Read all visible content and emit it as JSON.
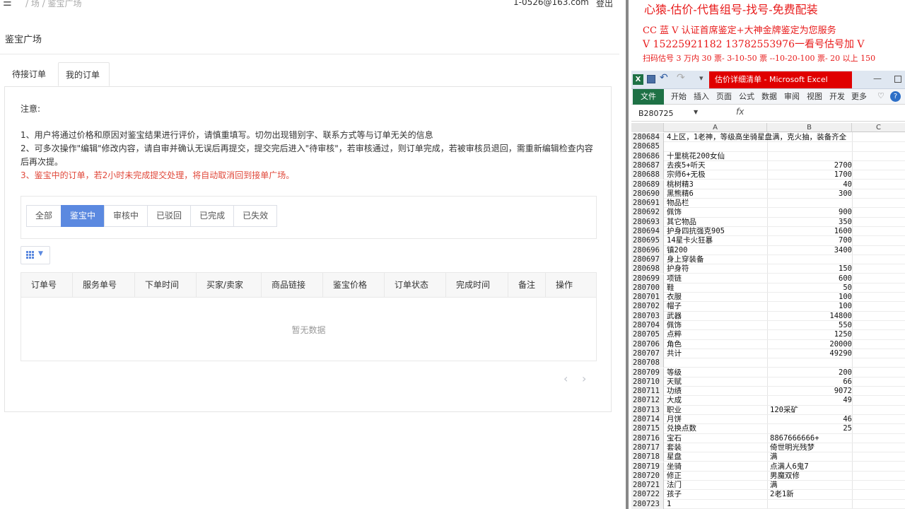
{
  "app": {
    "breadcrumb": "/ 场 / 鉴宝广场",
    "user_email": "1-0526@163.com",
    "logout": "登出",
    "page_title": "鉴宝广场",
    "tabs": [
      "待接订单",
      "我的订单"
    ],
    "notice": {
      "heading": "注意:",
      "line1": "1、用户将通过价格和原因对鉴宝结果进行评价，请慎重填写。切勿出现错别字、联系方式等与订单无关的信息",
      "line2": "2、可多次操作\"编辑\"修改内容，请自审并确认无误后再提交，提交完后进入\"待审核\"，若审核通过，则订单完成，若被审核员退回，需重新编辑检查内容后再次提。",
      "line3": "3、鉴宝中的订单，若2小时未完成提交处理，将自动取消回到接单广场。"
    },
    "filters": [
      "全部",
      "鉴宝中",
      "审核中",
      "已驳回",
      "已完成",
      "已失效"
    ],
    "active_filter": "鉴宝中",
    "columns": [
      "订单号",
      "服务单号",
      "下单时间",
      "买家/卖家",
      "商品链接",
      "鉴宝价格",
      "订单状态",
      "完成时间",
      "备注",
      "操作"
    ],
    "empty_text": "暂无数据",
    "accent_color": "#5b89e0"
  },
  "ad": {
    "line1": "心猿-估价-代售组号-找号-免费配装",
    "line2": "CC 蓝 V 认证首席鉴定+大神金牌鉴定为您服务",
    "line3": "V 15225921182    13782553976一看号估号加 V",
    "line4": "扫码估号 3 万内 30 票- 3-10-50 票 --10-20-100 票- 20 以上 150",
    "line5": "...",
    "color": "#e81b1b"
  },
  "excel": {
    "title": "估价详细清单 - Microsoft Excel",
    "file_tab": "文件",
    "ribbon_tabs": [
      "开始",
      "插入",
      "页面",
      "公式",
      "数据",
      "审阅",
      "视图",
      "开发",
      "更多"
    ],
    "name_box": "B280725",
    "fx": "fx",
    "col_headers": [
      "A",
      "B",
      "C"
    ],
    "rows": [
      {
        "n": "280684",
        "a": "4上区，1老神，等级高坐骑星盘满，克火抽，装备齐全",
        "b": "",
        "num": false
      },
      {
        "n": "280685",
        "a": "",
        "b": "",
        "num": false
      },
      {
        "n": "280686",
        "a": "十里桃花200女仙",
        "b": "",
        "num": false
      },
      {
        "n": "280687",
        "a": "去疾5+听天",
        "b": "2700",
        "num": true
      },
      {
        "n": "280688",
        "a": "宗师6+无极",
        "b": "1700",
        "num": true
      },
      {
        "n": "280689",
        "a": "桃树精3",
        "b": "40",
        "num": true
      },
      {
        "n": "280690",
        "a": "黑熊精6",
        "b": "300",
        "num": true
      },
      {
        "n": "280691",
        "a": "物品栏",
        "b": "",
        "num": false
      },
      {
        "n": "280692",
        "a": "佩饰",
        "b": "900",
        "num": true
      },
      {
        "n": "280693",
        "a": "其它物品",
        "b": "350",
        "num": true
      },
      {
        "n": "280694",
        "a": "护身四抗强克905",
        "b": "1600",
        "num": true
      },
      {
        "n": "280695",
        "a": "14星卡火狂暴",
        "b": "700",
        "num": true
      },
      {
        "n": "280696",
        "a": "镇200",
        "b": "3400",
        "num": true
      },
      {
        "n": "280697",
        "a": "身上穿装备",
        "b": "",
        "num": false
      },
      {
        "n": "280698",
        "a": "护身符",
        "b": "150",
        "num": true
      },
      {
        "n": "280699",
        "a": "项链",
        "b": "600",
        "num": true
      },
      {
        "n": "280700",
        "a": "鞋",
        "b": "50",
        "num": true
      },
      {
        "n": "280701",
        "a": "衣服",
        "b": "100",
        "num": true
      },
      {
        "n": "280702",
        "a": "帽子",
        "b": "100",
        "num": true
      },
      {
        "n": "280703",
        "a": "武器",
        "b": "14800",
        "num": true
      },
      {
        "n": "280704",
        "a": "佩饰",
        "b": "550",
        "num": true
      },
      {
        "n": "280705",
        "a": "点粹",
        "b": "1250",
        "num": true
      },
      {
        "n": "280706",
        "a": "角色",
        "b": "20000",
        "num": true
      },
      {
        "n": "280707",
        "a": "共计",
        "b": "49290",
        "num": true
      },
      {
        "n": "280708",
        "a": "",
        "b": "",
        "num": false
      },
      {
        "n": "280709",
        "a": "等级",
        "b": "200",
        "num": true
      },
      {
        "n": "280710",
        "a": "天赋",
        "b": "66",
        "num": true
      },
      {
        "n": "280711",
        "a": "功绩",
        "b": "9072",
        "num": true
      },
      {
        "n": "280712",
        "a": "大成",
        "b": "49",
        "num": true
      },
      {
        "n": "280713",
        "a": "职业",
        "b": "120采矿",
        "num": false
      },
      {
        "n": "280714",
        "a": "月饼",
        "b": "46",
        "num": true
      },
      {
        "n": "280715",
        "a": "兑换点数",
        "b": "25",
        "num": true
      },
      {
        "n": "280716",
        "a": "宝石",
        "b": "8867666666+",
        "num": false
      },
      {
        "n": "280717",
        "a": "套装",
        "b": "倚世明光残梦",
        "num": false
      },
      {
        "n": "280718",
        "a": "星盘",
        "b": "满",
        "num": false
      },
      {
        "n": "280719",
        "a": "坐骑",
        "b": "点满人6鬼7",
        "num": false
      },
      {
        "n": "280720",
        "a": "修正",
        "b": "男魔双修",
        "num": false
      },
      {
        "n": "280721",
        "a": "法门",
        "b": "满",
        "num": false
      },
      {
        "n": "280722",
        "a": "孩子",
        "b": "2老1新",
        "num": false
      },
      {
        "n": "280723",
        "a": "1",
        "b": "",
        "num": false
      }
    ]
  }
}
